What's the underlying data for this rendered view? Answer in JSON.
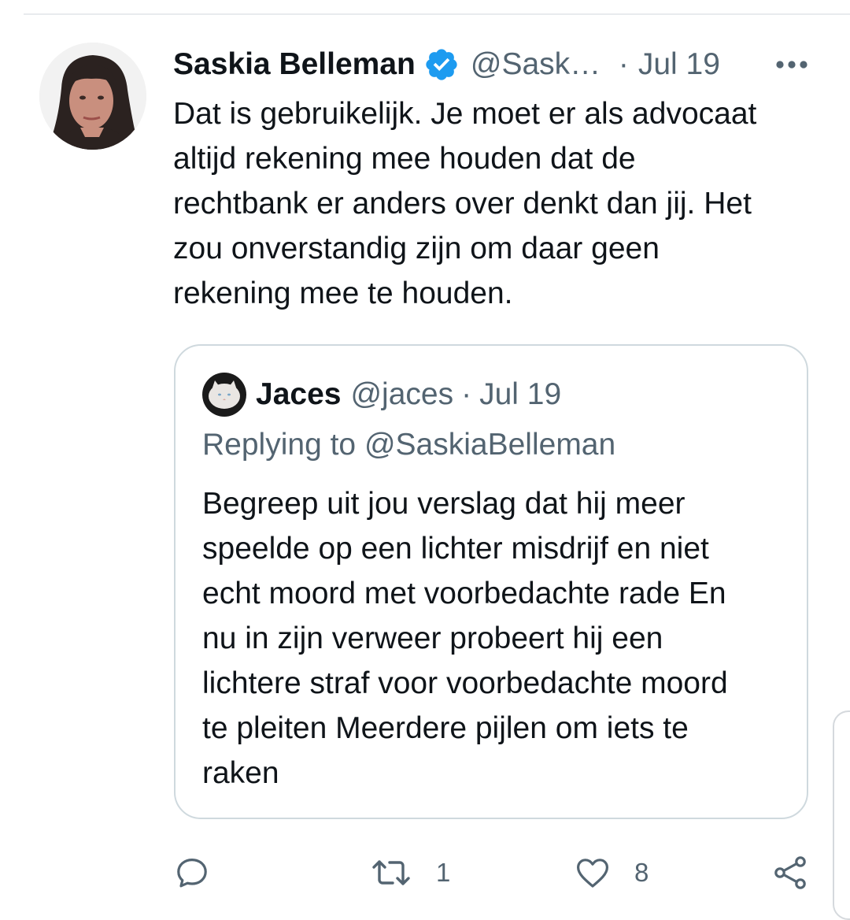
{
  "tweet": {
    "author_name": "Saskia Belleman",
    "author_handle": "@Saski…",
    "separator": "·",
    "date": "Jul 19",
    "text": "Dat is gebruikelijk. Je moet er als advocaat\naltijd rekening mee houden dat de\nrechtbank er anders over denkt dan jij. Het\nzou onverstandig zijn om daar geen\nrekening mee te houden."
  },
  "quote": {
    "author_name": "Jaces",
    "author_handle": "@jaces",
    "separator": "·",
    "date": "Jul 19",
    "replying_to": "Replying to @SaskiaBelleman",
    "text": "Begreep uit jou verslag dat hij meer\nspeelde op een lichter misdrijf en niet\necht moord met voorbedachte rade En\nnu in zijn verweer probeert hij een\nlichtere straf voor voorbedachte moord\nte pleiten Meerdere pijlen om iets te\nraken"
  },
  "actions": {
    "reply_icon": "speech-bubble-icon",
    "retweet_icon": "retweet-arrows-icon",
    "retweet_count": "1",
    "like_icon": "heart-icon",
    "like_count": "8",
    "share_icon": "share-nodes-icon"
  },
  "colors": {
    "text_primary": "#0f1419",
    "text_secondary": "#536471",
    "verified_blue": "#1d9bf0",
    "border": "#cfd9de"
  }
}
